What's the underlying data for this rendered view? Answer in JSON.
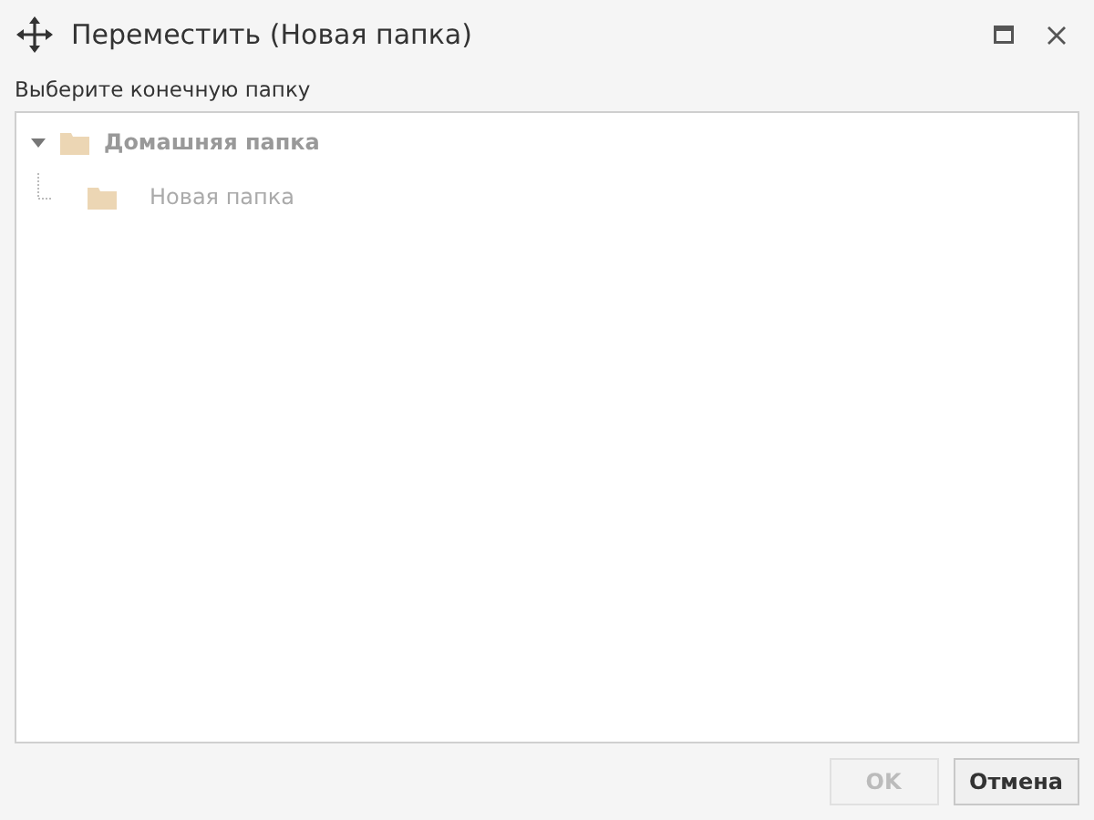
{
  "window": {
    "title": "Переместить (Новая папка)"
  },
  "prompt": "Выберите конечную папку",
  "tree": [
    {
      "label": "Домашняя папка",
      "expanded": true,
      "children": [
        {
          "label": "Новая папка"
        }
      ]
    }
  ],
  "buttons": [
    {
      "label": "OK",
      "disabled": true
    },
    {
      "label": "Отмена",
      "disabled": false
    }
  ]
}
